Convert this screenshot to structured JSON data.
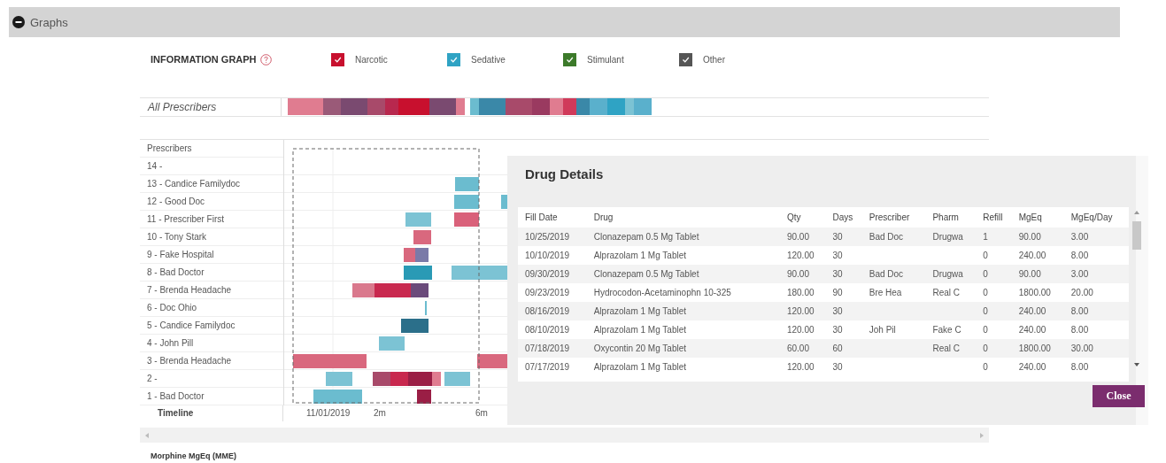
{
  "section": {
    "title": "Graphs",
    "expanded": true
  },
  "information_graph": {
    "title": "INFORMATION GRAPH",
    "legend": [
      {
        "label": "Narcotic",
        "checked": true,
        "color": "#c8102e"
      },
      {
        "label": "Sedative",
        "checked": true,
        "color": "#2fa3c4"
      },
      {
        "label": "Stimulant",
        "checked": true,
        "color": "#3c7a2a"
      },
      {
        "label": "Other",
        "checked": true,
        "color": "#555555"
      }
    ]
  },
  "all_prescribers": {
    "label": "All Prescribers"
  },
  "prescribers": {
    "header": "Prescribers",
    "rows": [
      "14 -",
      "13 - Candice Familydoc",
      "12 - Good Doc",
      "11 - Prescriber First",
      "10 - Tony Stark",
      "9 - Fake Hospital",
      "8 - Bad Doctor",
      "7 - Brenda Headache",
      "6 - Doc Ohio",
      "5 - Candice Familydoc",
      "4 - John Pill",
      "3 - Brenda Headache",
      "2 -",
      "1 - Bad Doctor"
    ],
    "timeline": {
      "label": "Timeline",
      "ticks": [
        "11/01/2019",
        "2m",
        "6m"
      ]
    }
  },
  "next_section": {
    "title": "Morphine MgEq (MME)"
  },
  "dialog": {
    "title": "Drug Details",
    "columns": [
      "Fill Date",
      "Drug",
      "Qty",
      "Days",
      "Prescriber",
      "Pharm",
      "Refill",
      "MgEq",
      "MgEq/Day"
    ],
    "rows": [
      [
        "10/25/2019",
        "Clonazepam 0.5 Mg Tablet",
        "90.00",
        "30",
        "Bad Doc",
        "Drugwa",
        "1",
        "90.00",
        "3.00"
      ],
      [
        "10/10/2019",
        "Alprazolam 1 Mg Tablet",
        "120.00",
        "30",
        null,
        null,
        "0",
        "240.00",
        "8.00"
      ],
      [
        "09/30/2019",
        "Clonazepam 0.5 Mg Tablet",
        "90.00",
        "30",
        "Bad Doc",
        "Drugwa",
        "0",
        "90.00",
        "3.00"
      ],
      [
        "09/23/2019",
        "Hydrocodon-Acetaminophn 10-325",
        "180.00",
        "90",
        "Bre Hea",
        "Real C",
        "0",
        "1800.00",
        "20.00"
      ],
      [
        "08/16/2019",
        "Alprazolam 1 Mg Tablet",
        "120.00",
        "30",
        null,
        null,
        "0",
        "240.00",
        "8.00"
      ],
      [
        "08/10/2019",
        "Alprazolam 1 Mg Tablet",
        "120.00",
        "30",
        "Joh Pil",
        "Fake C",
        "0",
        "240.00",
        "8.00"
      ],
      [
        "07/18/2019",
        "Oxycontin 20 Mg Tablet",
        "60.00",
        "60",
        null,
        "Real C",
        "0",
        "1800.00",
        "30.00"
      ],
      [
        "07/17/2019",
        "Alprazolam 1 Mg Tablet",
        "120.00",
        "30",
        null,
        null,
        "0",
        "240.00",
        "8.00"
      ]
    ],
    "close_button": "Close"
  }
}
